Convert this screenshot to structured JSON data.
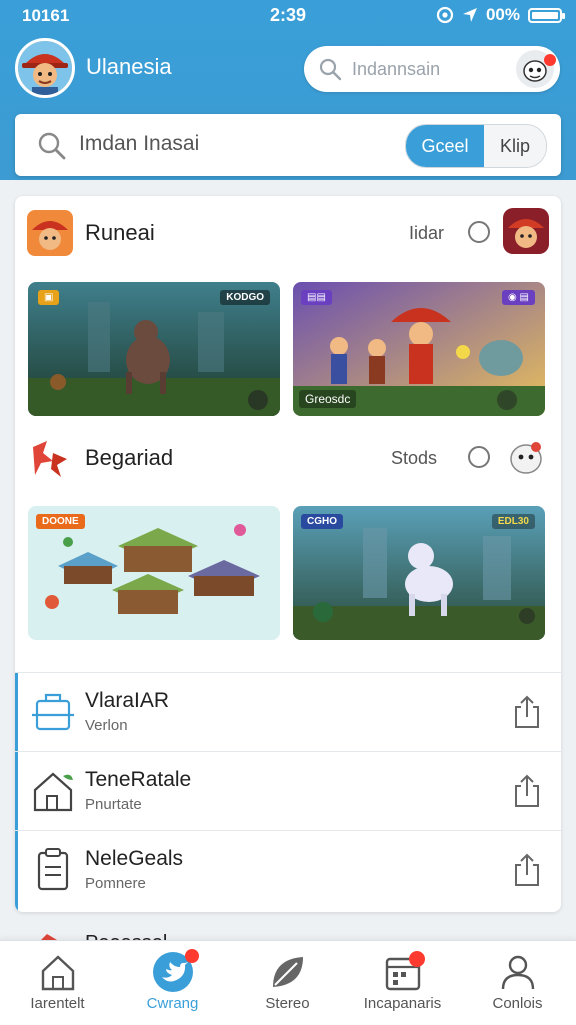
{
  "status_bar": {
    "left": "10161",
    "time": "2:39",
    "battery": "00%"
  },
  "header": {
    "title": "Ulanesia",
    "search_placeholder": "Indannsain",
    "main_search_text": "Imdan Inasai",
    "segment": [
      "Gceel",
      "Klip"
    ]
  },
  "sections": [
    {
      "title": "Runeai",
      "action": "Iidar",
      "tiles": [
        {
          "tag": "",
          "badge": "KODGO"
        },
        {
          "tag": "",
          "caption": "Greosdc"
        }
      ]
    },
    {
      "title": "Begariad",
      "action": "Stods",
      "tiles": [
        {
          "tag": "DOONE"
        },
        {
          "tag": "CGHO",
          "badge": "EDL30"
        }
      ]
    }
  ],
  "list": [
    {
      "title": "VlaraIAR",
      "sub": "Verlon"
    },
    {
      "title": "TeneRatale",
      "sub": "Pnurtate"
    },
    {
      "title": "NeleGeals",
      "sub": "Pomnere"
    }
  ],
  "peek_text": "Peeassel",
  "nav": [
    {
      "label": "Iarentelt",
      "icon": "home-icon"
    },
    {
      "label": "Cwrang",
      "icon": "bird-icon"
    },
    {
      "label": "Stereo",
      "icon": "leaf-icon"
    },
    {
      "label": "Incapanaris",
      "icon": "calendar-icon"
    },
    {
      "label": "Conlois",
      "icon": "user-icon"
    }
  ],
  "colors": {
    "primary": "#3a9fd8",
    "badge": "#ff3b30"
  }
}
